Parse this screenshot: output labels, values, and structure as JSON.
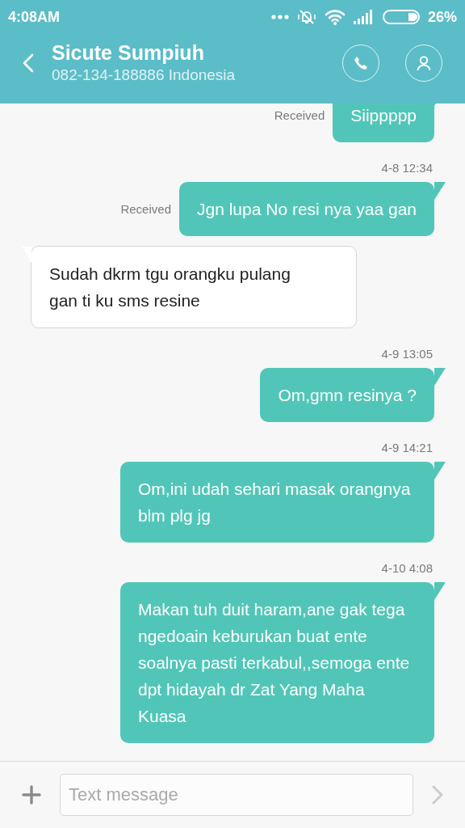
{
  "status_bar": {
    "time": "4:08AM",
    "battery": "26%"
  },
  "header": {
    "name": "Sicute Sumpiuh",
    "subtitle": "082-134-188886 Indonesia"
  },
  "messages": [
    {
      "kind": "sent",
      "text": "Siippppp",
      "status": "Received"
    },
    {
      "kind": "sent",
      "timestamp": "4-8 12:34",
      "text": "Jgn lupa No resi nya yaa gan",
      "status": "Received"
    },
    {
      "kind": "received",
      "text": "Sudah dkrm tgu orangku pulang gan ti ku sms resine"
    },
    {
      "kind": "sent",
      "timestamp": "4-9 13:05",
      "text": "Om,gmn resinya ?"
    },
    {
      "kind": "sent",
      "timestamp": "4-9 14:21",
      "text": "Om,ini udah sehari masak orangnya blm plg jg"
    },
    {
      "kind": "sent",
      "timestamp": "4-10 4:08",
      "text": "Makan tuh duit haram,ane gak tega ngedoain keburukan buat ente soalnya pasti terkabul,,semoga ente dpt hidayah dr Zat Yang Maha Kuasa"
    }
  ],
  "composer": {
    "placeholder": "Text message"
  }
}
